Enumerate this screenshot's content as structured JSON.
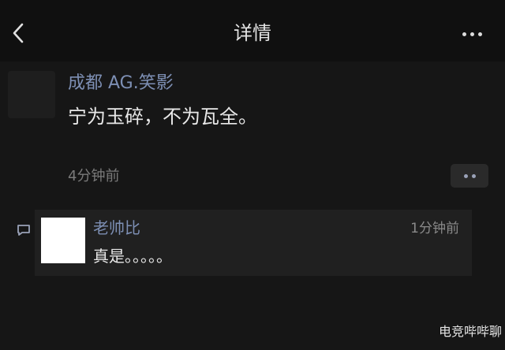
{
  "header": {
    "title": "详情"
  },
  "post": {
    "author": "成都 AG.笑影",
    "content": "宁为玉碎，不为瓦全。",
    "time": "4分钟前"
  },
  "comment": {
    "author": "老帅比",
    "time": "1分钟前",
    "content": "真是。。。。。"
  },
  "watermark": {
    "text": "电竞哔哔聊"
  },
  "icons": {
    "back": "chevron-left-icon",
    "more": "more-dots-icon",
    "post_action": "comment-like-dots-icon",
    "comment": "comment-bubble-icon"
  },
  "colors": {
    "background": "#161616",
    "topbar": "#101010",
    "name_blue": "#7d8fb4",
    "text": "#e8e8e8",
    "muted": "#7a7a7a"
  }
}
